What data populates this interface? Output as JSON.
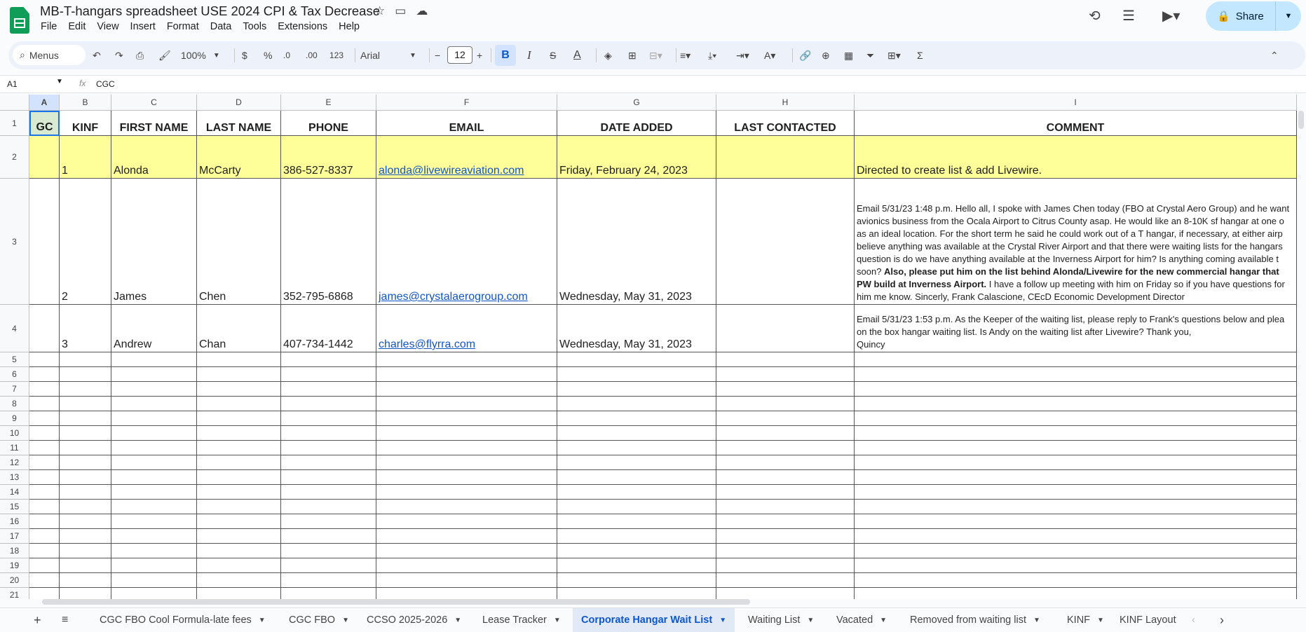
{
  "doc": {
    "title": "MB-T-hangars spreadsheet USE 2024 CPI & Tax Decrease"
  },
  "menu": [
    "File",
    "Edit",
    "View",
    "Insert",
    "Format",
    "Data",
    "Tools",
    "Extensions",
    "Help"
  ],
  "share_label": "Share",
  "toolbar": {
    "search": "Menus",
    "zoom": "100%",
    "currency": "$",
    "percent": "%",
    "dec_minus": ".0",
    "dec_plus": ".00",
    "format123": "123",
    "font": "Arial",
    "size": "12",
    "bold": "B",
    "italic": "I",
    "strike": "S",
    "textcolor": "A"
  },
  "formula": {
    "ref": "A1",
    "fx": "fx",
    "value": "CGC"
  },
  "columns": [
    "A",
    "B",
    "C",
    "D",
    "E",
    "F",
    "G",
    "H",
    "I"
  ],
  "headers": [
    "GC",
    "KINF",
    "FIRST NAME",
    "LAST NAME",
    "PHONE",
    "EMAIL",
    "DATE ADDED",
    "LAST CONTACTED",
    "COMMENT"
  ],
  "rows": [
    {
      "num": "1",
      "kinf": "1",
      "first": "Alonda",
      "last": "McCarty",
      "phone": "386-527-8337",
      "email": "alonda@livewireaviation.com",
      "date": "Friday, February 24, 2023",
      "contacted": "",
      "comment": "Directed to create list & add Livewire."
    },
    {
      "num": "2",
      "kinf": "2",
      "first": "James",
      "last": "Chen",
      "phone": "352-795-6868",
      "email": " james@crystalaerogroup.com",
      "date": "Wednesday, May 31, 2023",
      "contacted": "",
      "comment_a": "Email 5/31/23 1:48 p.m. Hello all, I spoke with James Chen today (FBO at Crystal Aero Group) and he want avionics business from the Ocala Airport to Citrus County asap.  He would like an 8-10K sf hangar at one o as an ideal location.  For the short term he said he could work out of a T hangar, if necessary, at either airp believe anything was available at the Crystal River Airport and that there were waiting lists for the hangars question is do we have anything available at the Inverness Airport for him?  Is anything coming available t soon? ",
      "comment_b": "Also, please put him on the list behind Alonda/Livewire for the new commercial hangar that PW build at Inverness Airport.",
      "comment_c": "  I have a follow up meeting with him on Friday so if you have questions for him me know. Sincerly,  Frank Calascione, CEcD Economic Development Director"
    },
    {
      "num": "3",
      "kinf": "3",
      "first": "Andrew",
      "last": "Chan",
      "phone": "407-734-1442",
      "email": "charles@flyrra.com ",
      "date": "Wednesday, May 31, 2023",
      "contacted": "",
      "comment": "Email 5/31/23 1:53 p.m. As the Keeper of the waiting list, please reply to Frank's questions below and plea on the box hangar waiting list. Is Andy on the waiting list after Livewire? Thank you,",
      "comment_2": "Quincy"
    }
  ],
  "row_numbers": [
    "1",
    "2",
    "3",
    "4",
    "5",
    "6",
    "7",
    "8",
    "9",
    "10",
    "11",
    "12",
    "13",
    "14",
    "15",
    "16",
    "17",
    "18",
    "19",
    "20",
    "21"
  ],
  "tabs": [
    "CGC FBO Cool Formula-late fees",
    "CGC FBO",
    "CCSO 2025-2026",
    "Lease Tracker",
    "Corporate Hangar Wait List",
    "Waiting List",
    "Vacated",
    "Removed from waiting list",
    "KINF",
    "KINF Layout"
  ],
  "active_tab": "Corporate Hangar Wait List"
}
